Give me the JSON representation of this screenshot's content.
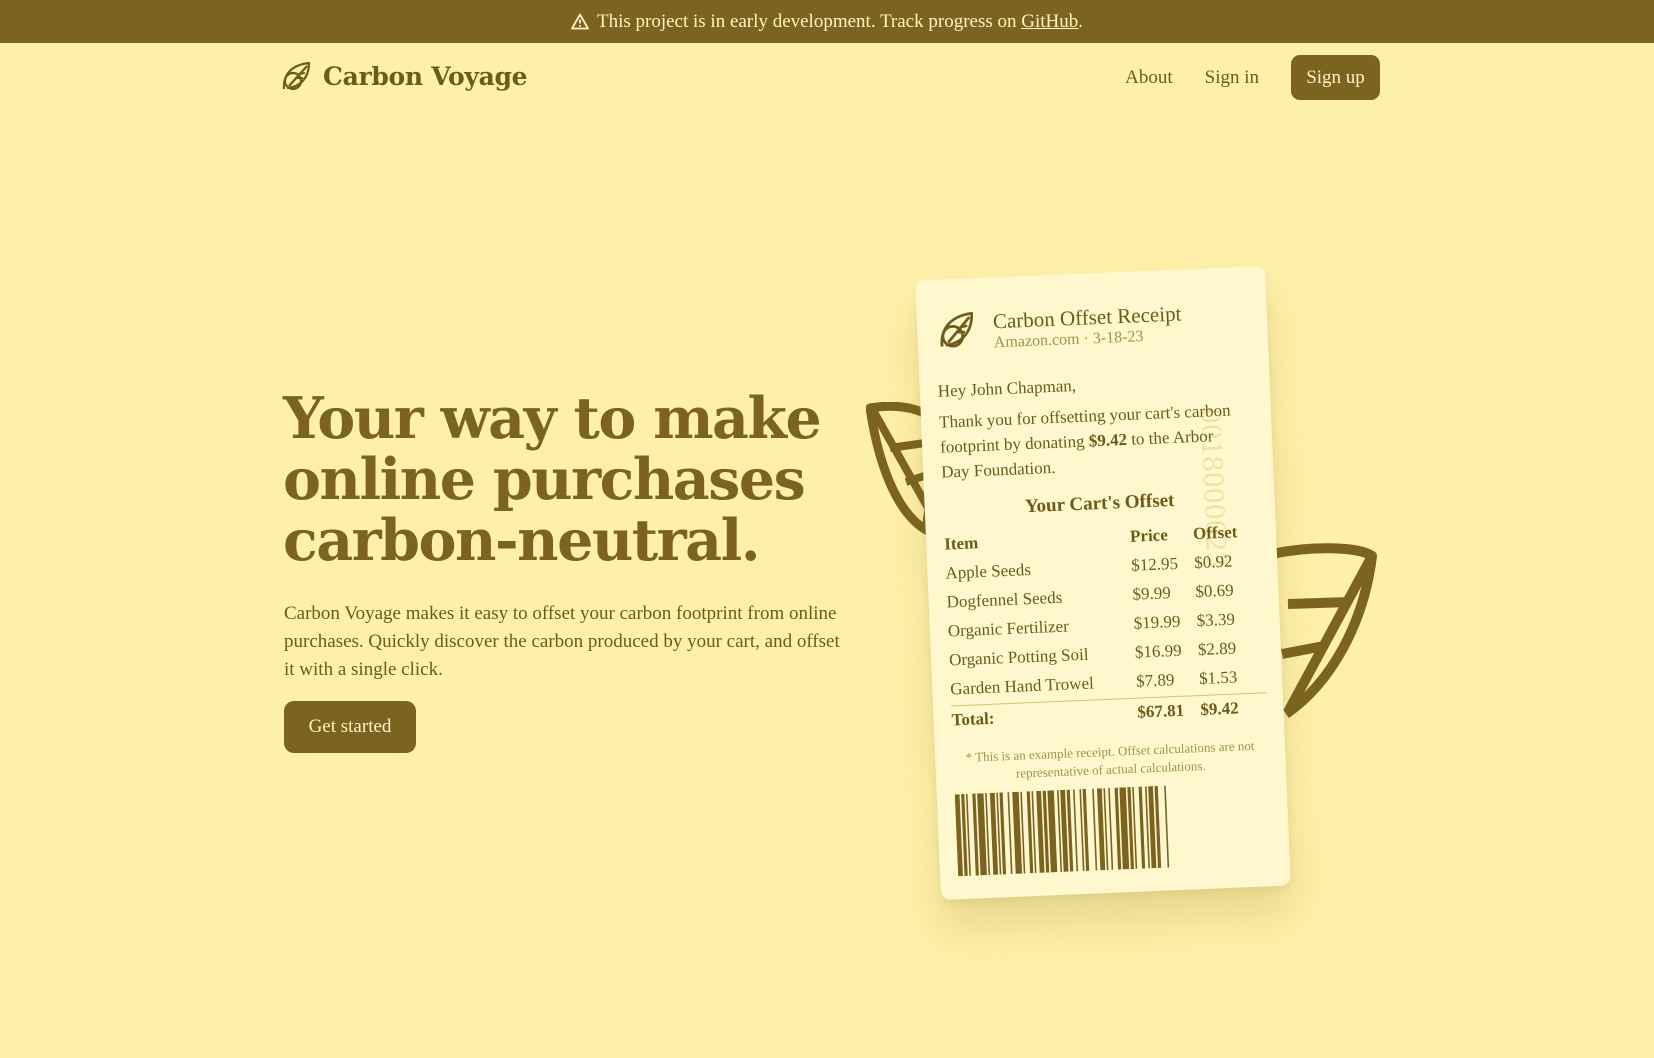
{
  "banner": {
    "text": "This project is in early development. Track progress on ",
    "link": "GitHub",
    "suffix": "."
  },
  "header": {
    "brand": "Carbon Voyage",
    "nav": {
      "about": "About",
      "signin": "Sign in",
      "signup": "Sign up"
    }
  },
  "hero": {
    "title_line1": "Your way to make",
    "title_line2": "online purchases",
    "title_line3": "carbon-neutral.",
    "description": "Carbon Voyage makes it easy to offset your carbon footprint from online purchases. Quickly discover the carbon produced by your cart, and offset it with a single click.",
    "cta": "Get started"
  },
  "receipt": {
    "title": "Carbon Offset Receipt",
    "subtitle": "Amazon.com · 3-18-23",
    "greeting": "Hey John Chapman,",
    "message_pre": "Thank you for offsetting your cart's carbon footprint by donating ",
    "message_amount": "$9.42",
    "message_post": " to the Arbor Day Foundation.",
    "serial": "0018000023",
    "table_title": "Your Cart's Offset",
    "columns": {
      "item": "Item",
      "price": "Price",
      "offset": "Offset"
    },
    "rows": [
      {
        "item": "Apple Seeds",
        "price": "$12.95",
        "offset": "$0.92"
      },
      {
        "item": "Dogfennel Seeds",
        "price": "$9.99",
        "offset": "$0.69"
      },
      {
        "item": "Organic Fertilizer",
        "price": "$19.99",
        "offset": "$3.39"
      },
      {
        "item": "Organic Potting Soil",
        "price": "$16.99",
        "offset": "$2.89"
      },
      {
        "item": "Garden Hand Trowel",
        "price": "$7.89",
        "offset": "$1.53"
      }
    ],
    "total": {
      "label": "Total:",
      "price": "$67.81",
      "offset": "$9.42"
    },
    "note": "* This is an example receipt. Offset calculations are not representative of actual calculations."
  },
  "colors": {
    "background": "#fef0a9",
    "accent": "#7c6420",
    "text": "#6e5a1b",
    "receipt": "#fff8cf"
  },
  "icons": {
    "warning": "warning-triangle-icon",
    "logo": "leaf-icon"
  }
}
